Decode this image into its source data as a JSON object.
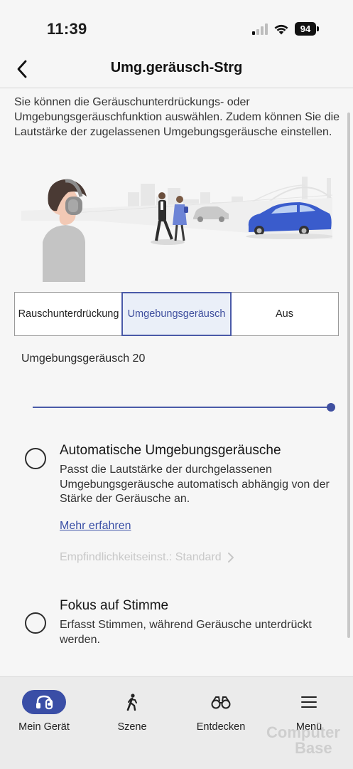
{
  "status_bar": {
    "time": "11:39",
    "battery": "94"
  },
  "nav": {
    "title": "Umg.geräusch-Strg"
  },
  "intro_text": "Sie können die Geräuschunterdrückungs- oder Umgebungsgeräuschfunktion auswählen. Zudem können Sie die Lautstärke der zugelassenen Umgebungsgeräusche einstellen.",
  "mode_selector": {
    "options": [
      {
        "label": "Rauschunterdrückung"
      },
      {
        "label": "Umgebungsgeräusch"
      },
      {
        "label": "Aus"
      }
    ],
    "selected": "Umgebungsgeräusch"
  },
  "ambient_level": {
    "label": "Umgebungsgeräusch 20",
    "value": 20,
    "max": 20
  },
  "auto_ambient": {
    "title": "Automatische Umgebungsgeräusche",
    "description": "Passt die Lautstärke der durchgelassenen Umgebungsgeräusche automatisch abhängig von der Stärke der Geräusche an.",
    "learn_more": "Mehr erfahren",
    "sensitivity": "Empfindlichkeitseinst.: Standard",
    "checked": false
  },
  "voice_focus": {
    "title": "Fokus auf Stimme",
    "description": "Erfasst Stimmen, während Geräusche unterdrückt werden.",
    "checked": false
  },
  "tab_bar": {
    "tabs": [
      {
        "label": "Mein Gerät",
        "icon": "headphones-icon",
        "active": true
      },
      {
        "label": "Szene",
        "icon": "walking-icon",
        "active": false
      },
      {
        "label": "Entdecken",
        "icon": "binoculars-icon",
        "active": false
      },
      {
        "label": "Menü",
        "icon": "menu-icon",
        "active": false
      }
    ]
  },
  "watermark": {
    "line1": "Computer",
    "line2": "Base"
  },
  "colors": {
    "accent": "#3a4ea6",
    "background": "#f6f6f6",
    "disabled_text": "#c8c8c8"
  }
}
